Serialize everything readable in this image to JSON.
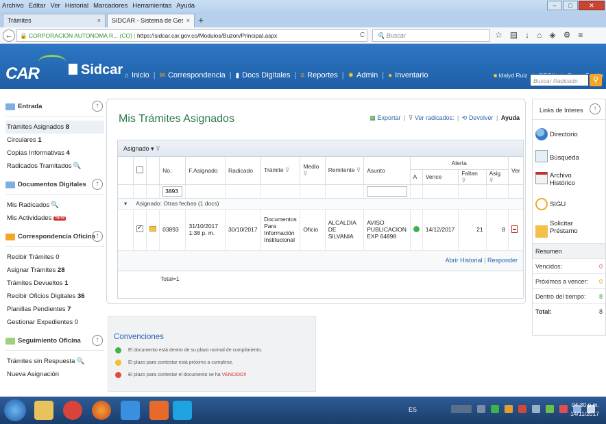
{
  "browser": {
    "menu": [
      "Archivo",
      "Editar",
      "Ver",
      "Historial",
      "Marcadores",
      "Herramientas",
      "Ayuda"
    ],
    "tabs": [
      {
        "label": "Trámites",
        "close": "×"
      },
      {
        "label": "SIDCAR - Sistema de Gestión Doc",
        "close": "×"
      }
    ],
    "new_tab": "+",
    "url_org": "CORPORACION AUTONOMA R... (CO)",
    "url": "https://sidcar.car.gov.co/Modulos/Buzon/Principal.aspx",
    "search_placeholder": "Buscar"
  },
  "header": {
    "logo_car": "CAR",
    "logo_app": "Sidcar",
    "nav": [
      "Inicio",
      "Correspondencia",
      "Docs Digitales",
      "Reportes",
      "Admin",
      "Inventario"
    ],
    "user": "Idalyd Ruiz",
    "dept": "DRSU",
    "logout": "Cerrar Sesión",
    "search_placeholder": "Buscar Radicado"
  },
  "sidebar": {
    "sections": [
      {
        "title": "Entrada",
        "items": [
          {
            "label": "Trámites Asignados",
            "count": "8",
            "active": true
          },
          {
            "label": "Circulares",
            "count": "1"
          },
          {
            "label": "Copias Informativas",
            "count": "4"
          },
          {
            "label": "Radicados Tramitados",
            "count": ""
          }
        ]
      },
      {
        "title": "Documentos Digitales",
        "items": [
          {
            "label": "Mis Radicados",
            "count": ""
          },
          {
            "label": "Mis Actividades",
            "count": ""
          }
        ]
      },
      {
        "title": "Correspondencia Oficina",
        "items": [
          {
            "label": "Recibir Trámites",
            "count": "0"
          },
          {
            "label": "Asignar Trámites",
            "count": "28"
          },
          {
            "label": "Trámites Devueltos",
            "count": "1"
          },
          {
            "label": "Recibir Oficios Digitales",
            "count": "36"
          },
          {
            "label": "Planillas Pendientes",
            "count": "7"
          },
          {
            "label": "Gestionar Expedientes",
            "count": "0"
          }
        ]
      },
      {
        "title": "Seguimiento Oficina",
        "items": [
          {
            "label": "Trámites sin Respuesta",
            "count": ""
          },
          {
            "label": "Nueva Asignación",
            "count": ""
          }
        ]
      }
    ],
    "new_badge": "NEW"
  },
  "main": {
    "title": "Mis Trámites Asignados",
    "export": "Exportar",
    "ver_radicados": "Ver radicados:",
    "devolver": "Devolver",
    "ayuda": "Ayuda",
    "group_by": "Asignado",
    "columns": {
      "no": "No.",
      "fasignado": "F.Asignado",
      "radicado": "Radicado",
      "tramite": "Trámite",
      "medio": "Medio",
      "remitente": "Remitente",
      "asunto": "Asunto",
      "alerta": "Alerta",
      "a": "A",
      "vence": "Vence",
      "faltan": "Faltan",
      "asig": "Asig",
      "ver": "Ver"
    },
    "filter_no": "3893",
    "group_row": "Asignado: Otras fechas (1 docs)",
    "rows": [
      {
        "no": "03893",
        "fasignado": "31/10/2017 1:38 p. m.",
        "radicado": "30/10/2017",
        "tramite": "Documentos Para Información Institucional",
        "medio": "Oficio",
        "remitente": "ALCALDIA DE SILVANIA",
        "asunto": "AVISO PUBLICACION EXP 64898",
        "vence": "14/12/2017",
        "faltan": "21",
        "asig": "8"
      }
    ],
    "abrir_historial": "Abrir Historial",
    "responder": "Responder",
    "total": "Total=1"
  },
  "conventions": {
    "title": "Convenciones",
    "green": "El documento está dentro de su plazo normal de cumplimiento.",
    "yellow": "El plazo para contestar está próximo a cumplirse.",
    "red_prefix": "El plazo para contestar el documento se ha",
    "red_word": "VENCIDO!!"
  },
  "right": {
    "title": "Links de Interes",
    "links": [
      "Directorio",
      "Búsqueda",
      "Archivo Histórico",
      "SIGU",
      "Solicitar Préstamo"
    ],
    "resumen_title": "Resumen",
    "resumen": [
      {
        "label": "Vencidos:",
        "value": "0",
        "color": "#d9534f"
      },
      {
        "label": "Próximos a vencer:",
        "value": "0",
        "color": "#e0a100"
      },
      {
        "label": "Dentro del tiempo:",
        "value": "8",
        "color": "#3a9a3a"
      },
      {
        "label": "Total:",
        "value": "8",
        "color": "#333333"
      }
    ]
  },
  "taskbar": {
    "lang": "ES",
    "time": "04:30 p.m.",
    "date": "14/11/2017"
  }
}
